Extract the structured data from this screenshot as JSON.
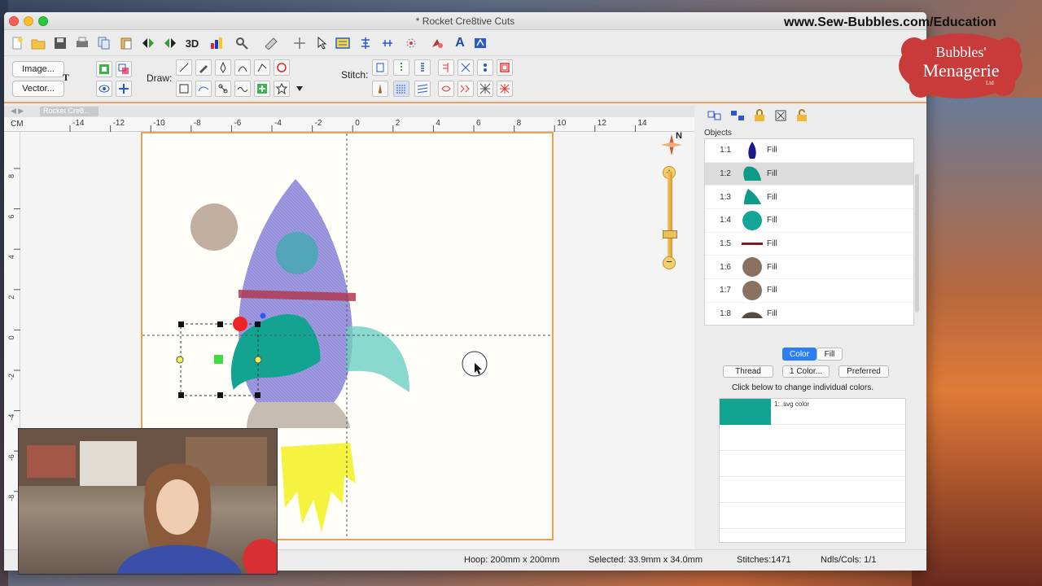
{
  "window": {
    "title": "* Rocket Cre8tive Cuts"
  },
  "overlay": {
    "url": "www.Sew-Bubbles.com/Education",
    "logo_line1": "Bubbles'",
    "logo_line2": "Menagerie",
    "logo_ltd": "Ltd"
  },
  "toolbar1": {
    "icons": [
      "new-icon",
      "open-icon",
      "save-icon",
      "print-icon",
      "copy-icon",
      "paste-icon",
      "flip-horizontal-icon",
      "flip-vertical-icon",
      "3d-view-icon",
      "bar-chart-icon",
      "magnifier-icon",
      "ruler-icon",
      "crosshair-icon",
      "pointer-icon",
      "grid-icon",
      "align-icon",
      "distribute-icon",
      "explode-icon",
      "color-drop-icon",
      "text-icon",
      "lettering-icon"
    ],
    "label_3d": "3D",
    "label_text": "A"
  },
  "toolbar2": {
    "image_btn": "Image...",
    "vector_btn": "Vector...",
    "draw_label": "Draw:",
    "stitch_label": "Stitch:",
    "text_tool_label": "T"
  },
  "canvas": {
    "tab_label": "Rocket Cre8...",
    "unit_label": "CM",
    "top_ticks": [
      "-14",
      "-12",
      "-10",
      "-8",
      "-6",
      "-4",
      "-2",
      "0",
      "2",
      "4",
      "6",
      "8",
      "10",
      "12",
      "14"
    ],
    "left_ticks": [
      "8",
      "6",
      "4",
      "2",
      "0",
      "-2",
      "-4",
      "-6",
      "-8"
    ],
    "compass_label": "N"
  },
  "objects_panel": {
    "header": "Objects",
    "rows": [
      {
        "num": "1:1",
        "type": "Fill",
        "color": "#1a1a8a",
        "shape": "drop"
      },
      {
        "num": "1:2",
        "type": "Fill",
        "color": "#0e9a88",
        "shape": "fin",
        "selected": true
      },
      {
        "num": "1:3",
        "type": "Fill",
        "color": "#0e9a88",
        "shape": "fin2"
      },
      {
        "num": "1:4",
        "type": "Fill",
        "color": "#13a596",
        "shape": "circle"
      },
      {
        "num": "1:5",
        "type": "Fill",
        "color": "#7a1a24",
        "shape": "line"
      },
      {
        "num": "1:6",
        "type": "Fill",
        "color": "#8a7260",
        "shape": "circle"
      },
      {
        "num": "1:7",
        "type": "Fill",
        "color": "#8a7260",
        "shape": "circle"
      },
      {
        "num": "1:8",
        "type": "Fill",
        "color": "#5a4a44",
        "shape": "dome"
      }
    ]
  },
  "color_panel": {
    "tab_color": "Color",
    "tab_fill": "Fill",
    "btn_thread": "Thread",
    "btn_one_color": "1 Color...",
    "btn_preferred": "Preferred",
    "hint": "Click below to change individual colors.",
    "swatch_label": "1: .svg color",
    "swatch_color": "#12a391"
  },
  "status": {
    "hoop": "Hoop: 200mm x 200mm",
    "selected": "Selected: 33.9mm x 34.0mm",
    "stitches": "Stitches:1471",
    "ndls": "Ndls/Cols: 1/1"
  },
  "colors": {
    "accent_orange": "#f0a050",
    "selection_blue": "#2b7ef7",
    "rocket_body": "#9f9ae0",
    "teal": "#12a391"
  }
}
